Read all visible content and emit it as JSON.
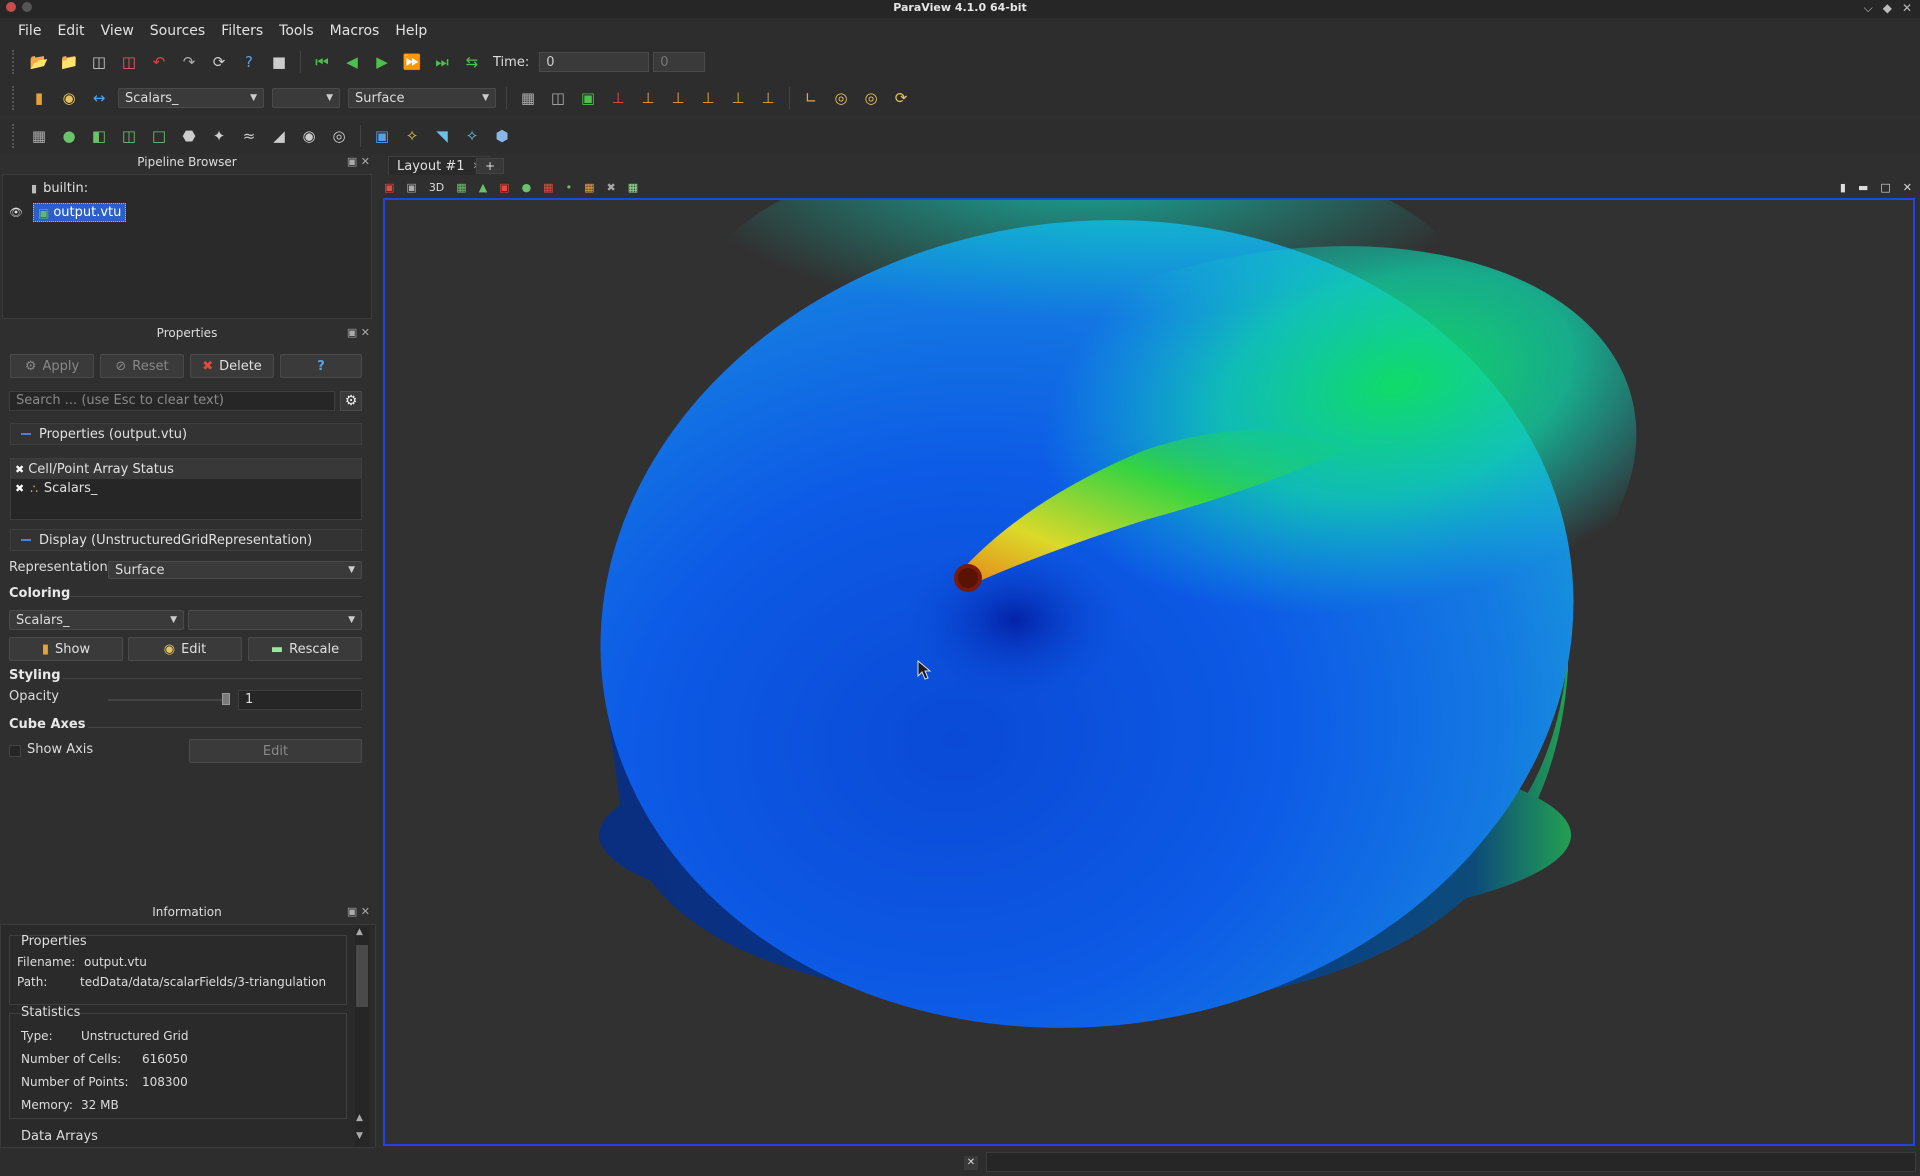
{
  "window": {
    "title": "ParaView 4.1.0 64-bit"
  },
  "menu": [
    "File",
    "Edit",
    "View",
    "Sources",
    "Filters",
    "Tools",
    "Macros",
    "Help"
  ],
  "toolbar_main": {
    "time_label": "Time:",
    "time_value": "0",
    "time_step": "0"
  },
  "toolbar_color": {
    "array_combo": "Scalars_",
    "component_combo": "",
    "representation_combo": "Surface"
  },
  "pipeline": {
    "title": "Pipeline Browser",
    "root": "builtin:",
    "item": "output.vtu"
  },
  "properties": {
    "title": "Properties",
    "apply": "Apply",
    "reset": "Reset",
    "delete": "Delete",
    "help": "?",
    "search_placeholder": "Search ... (use Esc to clear text)",
    "section_props": "Properties (output.vtu)",
    "array_status_header": "Cell/Point Array Status",
    "array_name": "Scalars_",
    "section_display": "Display (UnstructuredGridRepresentation)",
    "representation_label": "Representation",
    "representation_value": "Surface",
    "coloring_label": "Coloring",
    "coloring_array": "Scalars_",
    "coloring_component": "",
    "show": "Show",
    "edit": "Edit",
    "rescale": "Rescale",
    "styling_label": "Styling",
    "opacity_label": "Opacity",
    "opacity_value": "1",
    "cube_axes_label": "Cube Axes",
    "show_axis": "Show Axis",
    "cube_edit": "Edit"
  },
  "information": {
    "title": "Information",
    "properties_header": "Properties",
    "filename_label": "Filename:",
    "filename_value": "output.vtu",
    "path_label": "Path:",
    "path_value": "tedData/data/scalarFields/3-triangulation",
    "statistics_header": "Statistics",
    "type_label": "Type:",
    "type_value": "Unstructured Grid",
    "cells_label": "Number of Cells:",
    "cells_value": "616050",
    "points_label": "Number of Points:",
    "points_value": "108300",
    "memory_label": "Memory:",
    "memory_value": "32 MB",
    "data_arrays_header": "Data Arrays"
  },
  "view": {
    "tab_label": "Layout #1",
    "tab_add": "+",
    "mode_3d": "3D"
  },
  "colors": {
    "accent_border": "#1f45e6",
    "selection": "#2b5fc9"
  }
}
